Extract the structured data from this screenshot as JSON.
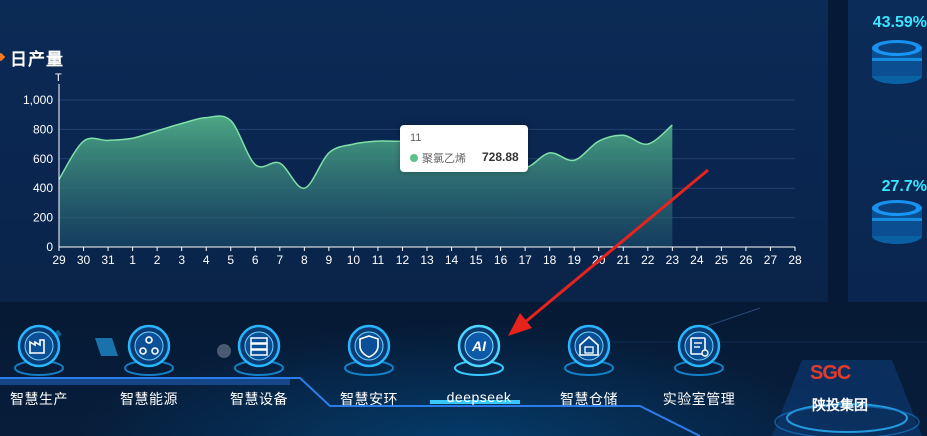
{
  "chart": {
    "title": "日产量",
    "unit": "T"
  },
  "chart_data": {
    "type": "area",
    "title": "日产量",
    "ylabel": "T",
    "ylim": [
      0,
      1000
    ],
    "yticks": [
      "0",
      "200",
      "400",
      "600",
      "800",
      "1,000"
    ],
    "x": [
      "29",
      "30",
      "31",
      "1",
      "2",
      "3",
      "4",
      "5",
      "6",
      "7",
      "8",
      "9",
      "10",
      "11",
      "12",
      "13",
      "14",
      "15",
      "16",
      "17",
      "18",
      "19",
      "20",
      "21",
      "22",
      "23",
      "24",
      "25",
      "26",
      "27",
      "28"
    ],
    "series": [
      {
        "name": "聚氯乙烯",
        "values": [
          460,
          720,
          725,
          740,
          790,
          840,
          880,
          860,
          560,
          570,
          400,
          640,
          700,
          720,
          720,
          740,
          728.88,
          660,
          610,
          540,
          640,
          590,
          720,
          760,
          700,
          830,
          null,
          null,
          null,
          null,
          null
        ]
      }
    ],
    "grid": true,
    "color": "#5ec08c"
  },
  "tooltip": {
    "x_label": "11",
    "series_name": "聚氯乙烯",
    "value": "728.88"
  },
  "right_panel": {
    "pct1": "43.59%",
    "pct2": "27.7%"
  },
  "nav": {
    "items": [
      {
        "label": "智慧生产",
        "icon": "factory-icon"
      },
      {
        "label": "智慧能源",
        "icon": "energy-icon"
      },
      {
        "label": "智慧设备",
        "icon": "server-icon"
      },
      {
        "label": "智慧安环",
        "icon": "shield-icon"
      },
      {
        "label": "deepseek",
        "icon": "ai-icon"
      },
      {
        "label": "智慧仓储",
        "icon": "warehouse-icon"
      },
      {
        "label": "实验室管理",
        "icon": "lab-icon"
      }
    ],
    "active_index": 4
  },
  "logo": {
    "mark": "SGC",
    "name": "陕投集团"
  },
  "colors": {
    "accent": "#39e6ff",
    "series": "#5ec08c",
    "arrow": "#e8231e"
  }
}
